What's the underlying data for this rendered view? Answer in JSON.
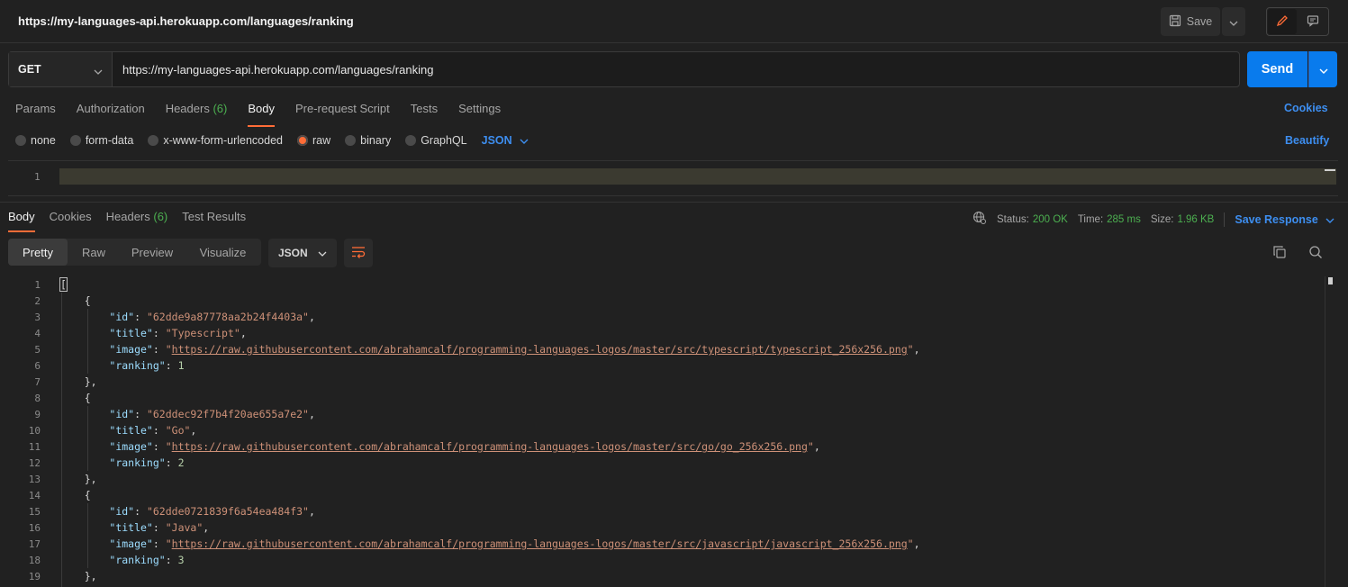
{
  "request": {
    "title": "https://my-languages-api.herokuapp.com/languages/ranking",
    "save_label": "Save",
    "method": "GET",
    "url": "https://my-languages-api.herokuapp.com/languages/ranking",
    "send_label": "Send"
  },
  "req_tabs": [
    {
      "label": "Params"
    },
    {
      "label": "Authorization"
    },
    {
      "label": "Headers",
      "count": "(6)"
    },
    {
      "label": "Body"
    },
    {
      "label": "Pre-request Script"
    },
    {
      "label": "Tests"
    },
    {
      "label": "Settings"
    }
  ],
  "cookies_label": "Cookies",
  "body_types": [
    "none",
    "form-data",
    "x-www-form-urlencoded",
    "raw",
    "binary",
    "GraphQL"
  ],
  "body_format": "JSON",
  "beautify_label": "Beautify",
  "request_editor": {
    "line": "1"
  },
  "resp_tabs": [
    {
      "label": "Body"
    },
    {
      "label": "Cookies"
    },
    {
      "label": "Headers",
      "count": "(6)"
    },
    {
      "label": "Test Results"
    }
  ],
  "response_meta": {
    "status_label": "Status:",
    "status_value": "200 OK",
    "time_label": "Time:",
    "time_value": "285 ms",
    "size_label": "Size:",
    "size_value": "1.96 KB",
    "save_response_label": "Save Response"
  },
  "view_tabs": [
    "Pretty",
    "Raw",
    "Preview",
    "Visualize"
  ],
  "response_format": "JSON",
  "code_lines": [
    {
      "n": "1",
      "text": "["
    },
    {
      "n": "2",
      "text": "    {"
    },
    {
      "n": "3",
      "text": "        \"id\": \"62dde9a87778aa2b24f4403a\","
    },
    {
      "n": "4",
      "text": "        \"title\": \"Typescript\","
    },
    {
      "n": "5",
      "text": "        \"image\": \"https://raw.githubusercontent.com/abrahamcalf/programming-languages-logos/master/src/typescript/typescript_256x256.png\","
    },
    {
      "n": "6",
      "text": "        \"ranking\": 1"
    },
    {
      "n": "7",
      "text": "    },"
    },
    {
      "n": "8",
      "text": "    {"
    },
    {
      "n": "9",
      "text": "        \"id\": \"62ddec92f7b4f20ae655a7e2\","
    },
    {
      "n": "10",
      "text": "        \"title\": \"Go\","
    },
    {
      "n": "11",
      "text": "        \"image\": \"https://raw.githubusercontent.com/abrahamcalf/programming-languages-logos/master/src/go/go_256x256.png\","
    },
    {
      "n": "12",
      "text": "        \"ranking\": 2"
    },
    {
      "n": "13",
      "text": "    },"
    },
    {
      "n": "14",
      "text": "    {"
    },
    {
      "n": "15",
      "text": "        \"id\": \"62dde0721839f6a54ea484f3\","
    },
    {
      "n": "16",
      "text": "        \"title\": \"Java\","
    },
    {
      "n": "17",
      "text": "        \"image\": \"https://raw.githubusercontent.com/abrahamcalf/programming-languages-logos/master/src/javascript/javascript_256x256.png\","
    },
    {
      "n": "18",
      "text": "        \"ranking\": 3"
    },
    {
      "n": "19",
      "text": "    },"
    }
  ],
  "colors": {
    "accent_orange": "#ff6c37",
    "send_blue": "#097bed",
    "link_blue": "#3d8ef0",
    "status_green": "#4caf50",
    "json_key": "#9cdcfe",
    "json_string": "#ce9178",
    "json_number": "#b5cea8"
  },
  "icons": {
    "save": "save-icon",
    "edit": "pencil-icon",
    "comments": "comment-icon",
    "globe": "globe-icon",
    "wrap": "wrap-lines-icon",
    "copy": "copy-icon",
    "search": "search-icon"
  }
}
